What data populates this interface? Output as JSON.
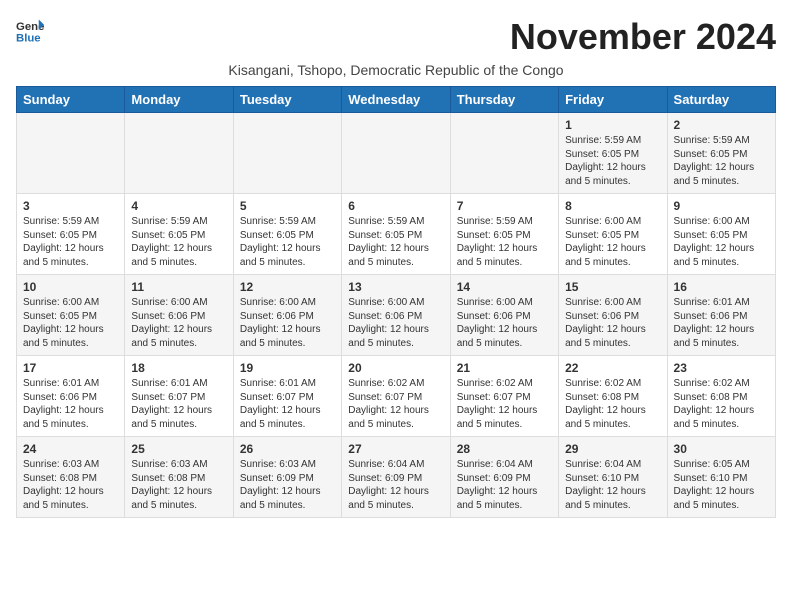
{
  "logo": {
    "line1": "General",
    "line2": "Blue"
  },
  "title": "November 2024",
  "subtitle": "Kisangani, Tshopo, Democratic Republic of the Congo",
  "days_of_week": [
    "Sunday",
    "Monday",
    "Tuesday",
    "Wednesday",
    "Thursday",
    "Friday",
    "Saturday"
  ],
  "weeks": [
    [
      {
        "day": "",
        "info": ""
      },
      {
        "day": "",
        "info": ""
      },
      {
        "day": "",
        "info": ""
      },
      {
        "day": "",
        "info": ""
      },
      {
        "day": "",
        "info": ""
      },
      {
        "day": "1",
        "info": "Sunrise: 5:59 AM\nSunset: 6:05 PM\nDaylight: 12 hours and 5 minutes."
      },
      {
        "day": "2",
        "info": "Sunrise: 5:59 AM\nSunset: 6:05 PM\nDaylight: 12 hours and 5 minutes."
      }
    ],
    [
      {
        "day": "3",
        "info": "Sunrise: 5:59 AM\nSunset: 6:05 PM\nDaylight: 12 hours and 5 minutes."
      },
      {
        "day": "4",
        "info": "Sunrise: 5:59 AM\nSunset: 6:05 PM\nDaylight: 12 hours and 5 minutes."
      },
      {
        "day": "5",
        "info": "Sunrise: 5:59 AM\nSunset: 6:05 PM\nDaylight: 12 hours and 5 minutes."
      },
      {
        "day": "6",
        "info": "Sunrise: 5:59 AM\nSunset: 6:05 PM\nDaylight: 12 hours and 5 minutes."
      },
      {
        "day": "7",
        "info": "Sunrise: 5:59 AM\nSunset: 6:05 PM\nDaylight: 12 hours and 5 minutes."
      },
      {
        "day": "8",
        "info": "Sunrise: 6:00 AM\nSunset: 6:05 PM\nDaylight: 12 hours and 5 minutes."
      },
      {
        "day": "9",
        "info": "Sunrise: 6:00 AM\nSunset: 6:05 PM\nDaylight: 12 hours and 5 minutes."
      }
    ],
    [
      {
        "day": "10",
        "info": "Sunrise: 6:00 AM\nSunset: 6:05 PM\nDaylight: 12 hours and 5 minutes."
      },
      {
        "day": "11",
        "info": "Sunrise: 6:00 AM\nSunset: 6:06 PM\nDaylight: 12 hours and 5 minutes."
      },
      {
        "day": "12",
        "info": "Sunrise: 6:00 AM\nSunset: 6:06 PM\nDaylight: 12 hours and 5 minutes."
      },
      {
        "day": "13",
        "info": "Sunrise: 6:00 AM\nSunset: 6:06 PM\nDaylight: 12 hours and 5 minutes."
      },
      {
        "day": "14",
        "info": "Sunrise: 6:00 AM\nSunset: 6:06 PM\nDaylight: 12 hours and 5 minutes."
      },
      {
        "day": "15",
        "info": "Sunrise: 6:00 AM\nSunset: 6:06 PM\nDaylight: 12 hours and 5 minutes."
      },
      {
        "day": "16",
        "info": "Sunrise: 6:01 AM\nSunset: 6:06 PM\nDaylight: 12 hours and 5 minutes."
      }
    ],
    [
      {
        "day": "17",
        "info": "Sunrise: 6:01 AM\nSunset: 6:06 PM\nDaylight: 12 hours and 5 minutes."
      },
      {
        "day": "18",
        "info": "Sunrise: 6:01 AM\nSunset: 6:07 PM\nDaylight: 12 hours and 5 minutes."
      },
      {
        "day": "19",
        "info": "Sunrise: 6:01 AM\nSunset: 6:07 PM\nDaylight: 12 hours and 5 minutes."
      },
      {
        "day": "20",
        "info": "Sunrise: 6:02 AM\nSunset: 6:07 PM\nDaylight: 12 hours and 5 minutes."
      },
      {
        "day": "21",
        "info": "Sunrise: 6:02 AM\nSunset: 6:07 PM\nDaylight: 12 hours and 5 minutes."
      },
      {
        "day": "22",
        "info": "Sunrise: 6:02 AM\nSunset: 6:08 PM\nDaylight: 12 hours and 5 minutes."
      },
      {
        "day": "23",
        "info": "Sunrise: 6:02 AM\nSunset: 6:08 PM\nDaylight: 12 hours and 5 minutes."
      }
    ],
    [
      {
        "day": "24",
        "info": "Sunrise: 6:03 AM\nSunset: 6:08 PM\nDaylight: 12 hours and 5 minutes."
      },
      {
        "day": "25",
        "info": "Sunrise: 6:03 AM\nSunset: 6:08 PM\nDaylight: 12 hours and 5 minutes."
      },
      {
        "day": "26",
        "info": "Sunrise: 6:03 AM\nSunset: 6:09 PM\nDaylight: 12 hours and 5 minutes."
      },
      {
        "day": "27",
        "info": "Sunrise: 6:04 AM\nSunset: 6:09 PM\nDaylight: 12 hours and 5 minutes."
      },
      {
        "day": "28",
        "info": "Sunrise: 6:04 AM\nSunset: 6:09 PM\nDaylight: 12 hours and 5 minutes."
      },
      {
        "day": "29",
        "info": "Sunrise: 6:04 AM\nSunset: 6:10 PM\nDaylight: 12 hours and 5 minutes."
      },
      {
        "day": "30",
        "info": "Sunrise: 6:05 AM\nSunset: 6:10 PM\nDaylight: 12 hours and 5 minutes."
      }
    ]
  ]
}
